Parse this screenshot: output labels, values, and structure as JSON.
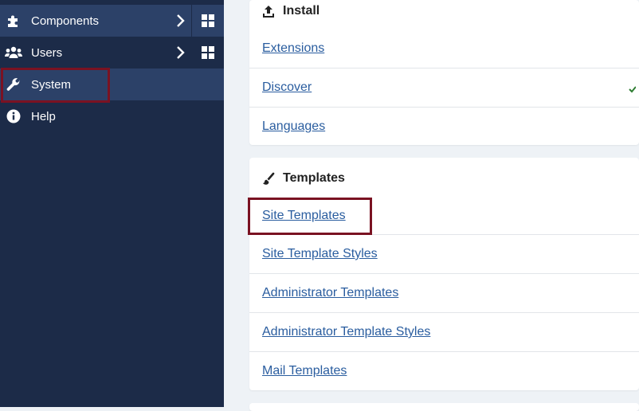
{
  "sidebar": {
    "items": [
      {
        "label": "Components",
        "icon": "puzzle-icon",
        "has_submenu": true,
        "has_dashboard": true
      },
      {
        "label": "Users",
        "icon": "users-icon",
        "has_submenu": true,
        "has_dashboard": true
      },
      {
        "label": "System",
        "icon": "wrench-icon",
        "active": true
      },
      {
        "label": "Help",
        "icon": "info-icon"
      }
    ]
  },
  "install": {
    "title": "Install",
    "items": [
      "Extensions",
      "Discover",
      "Languages"
    ]
  },
  "templates": {
    "title": "Templates",
    "items": [
      "Site Templates",
      "Site Template Styles",
      "Administrator Templates",
      "Administrator Template Styles",
      "Mail Templates"
    ]
  },
  "colors": {
    "sidebar_bg": "#1c2b48",
    "sidebar_active": "#2c4168",
    "link": "#2a5d9f",
    "highlight": "#7a1222",
    "page_bg": "#eef2f6"
  }
}
